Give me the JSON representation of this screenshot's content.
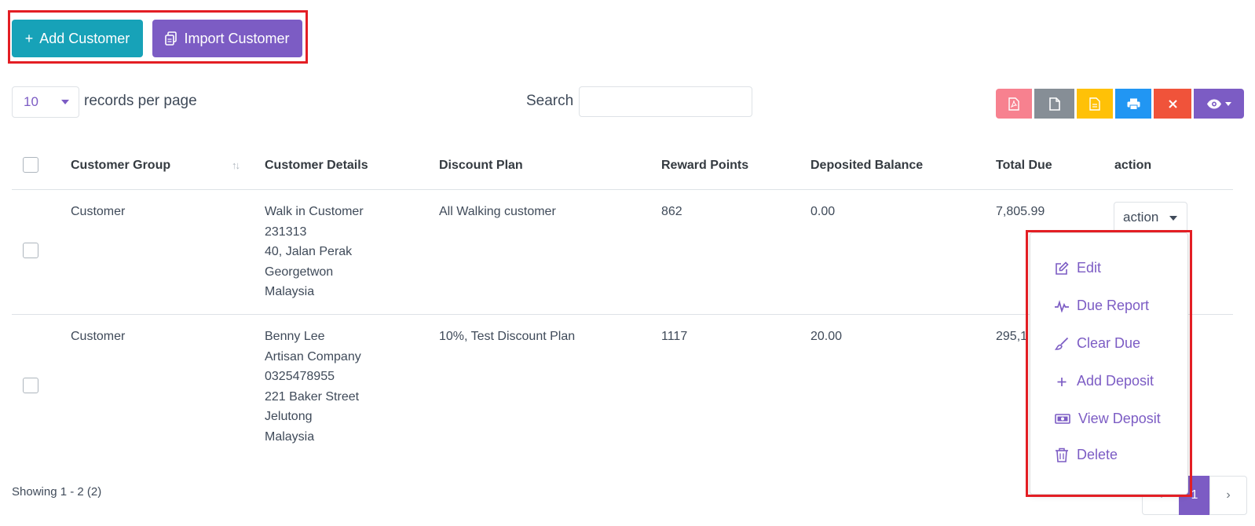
{
  "toolbar": {
    "add_customer": "Add Customer",
    "import_customer": "Import Customer"
  },
  "records": {
    "per_page_value": "10",
    "per_page_label": "records per page"
  },
  "search": {
    "label": "Search",
    "value": ""
  },
  "export_buttons": [
    "pdf-icon",
    "csv-icon",
    "excel-icon",
    "print-icon",
    "close-icon",
    "eye-icon"
  ],
  "table": {
    "headers": [
      "Customer Group",
      "Customer Details",
      "Discount Plan",
      "Reward Points",
      "Deposited Balance",
      "Total Due",
      "action"
    ],
    "rows": [
      {
        "group": "Customer",
        "details": [
          "Walk in Customer",
          "231313",
          "40, Jalan Perak",
          "Georgetwon",
          "Malaysia"
        ],
        "discount_plan": "All Walking customer",
        "reward_points": "862",
        "deposited_balance": "0.00",
        "total_due": "7,805.99",
        "action_label": "action"
      },
      {
        "group": "Customer",
        "details": [
          "Benny Lee",
          "Artisan Company",
          "0325478955",
          "221 Baker Street",
          "Jelutong",
          "Malaysia"
        ],
        "discount_plan": "10%, Test Discount Plan",
        "reward_points": "1117",
        "deposited_balance": "20.00",
        "total_due": "295,1"
      }
    ]
  },
  "action_menu": {
    "items": [
      "Edit",
      "Due Report",
      "Clear Due",
      "Add Deposit",
      "View Deposit",
      "Delete"
    ]
  },
  "footer": {
    "showing": "Showing 1 - 2 (2)"
  },
  "pagination": {
    "current": "1",
    "prev": "‹",
    "next": "›"
  },
  "colors": {
    "primary": "#7c5cc4",
    "info": "#17a2b8",
    "highlight": "#e31e24"
  }
}
